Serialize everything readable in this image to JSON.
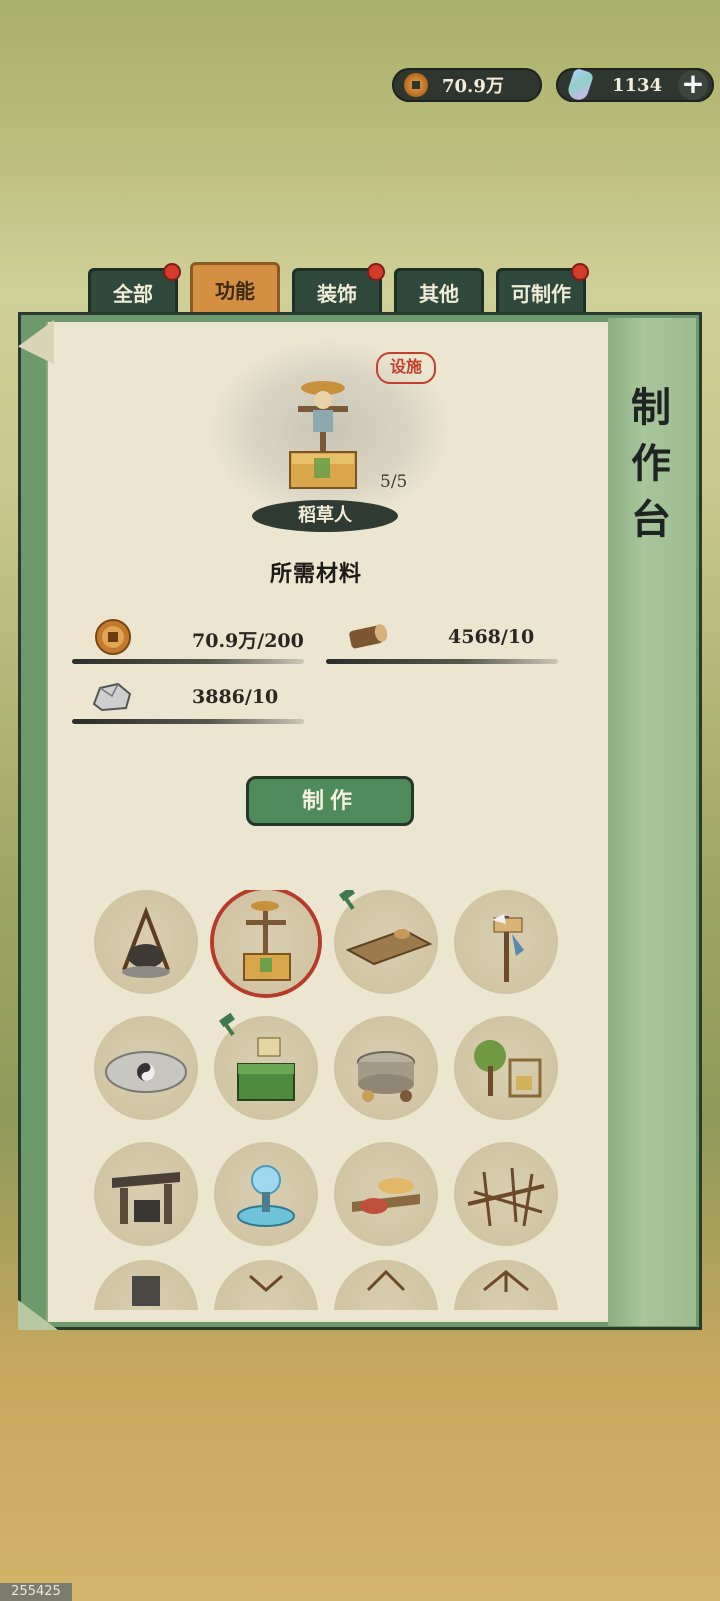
{
  "topbar": {
    "coins": "70.9万",
    "gems": "1134",
    "add_label": "+"
  },
  "tabs": [
    {
      "label": "全部",
      "badge": true,
      "active": false
    },
    {
      "label": "功能",
      "badge": false,
      "active": true
    },
    {
      "label": "装饰",
      "badge": true,
      "active": false
    },
    {
      "label": "其他",
      "badge": false,
      "active": false
    },
    {
      "label": "可制作",
      "badge": true,
      "active": false
    }
  ],
  "panel": {
    "title": "制作台"
  },
  "selected_item": {
    "stamp": "设施",
    "name": "稻草人",
    "count": "5/5",
    "materials_title": "所需材料",
    "materials": [
      {
        "icon": "copper-coin-icon",
        "value": "70.9万/200"
      },
      {
        "icon": "wood-log-icon",
        "value": "4568/10"
      },
      {
        "icon": "stone-icon",
        "value": "3886/10"
      }
    ],
    "craft_label": "制作"
  },
  "items": [
    {
      "name": "cooking-pot-tripod"
    },
    {
      "name": "scarecrow",
      "selected": true
    },
    {
      "name": "wooden-platform",
      "hammer": true
    },
    {
      "name": "bird-perch-signpost"
    },
    {
      "name": "bagua-floor-mat"
    },
    {
      "name": "green-storage-chest",
      "hammer": true
    },
    {
      "name": "stone-millstone"
    },
    {
      "name": "fruit-tree-farm"
    },
    {
      "name": "blacksmith-forge"
    },
    {
      "name": "crystal-orb-fountain"
    },
    {
      "name": "fish-drying-table"
    },
    {
      "name": "weaving-loom"
    },
    {
      "name": "bucket"
    },
    {
      "name": "wooden-frame"
    },
    {
      "name": "tent-frame"
    },
    {
      "name": "rack"
    }
  ],
  "footer_id": "255425",
  "colors": {
    "accent_tab": "#d48f43",
    "button": "#4f8a5b",
    "paper": "#ece6d1",
    "badge": "#d23a2a"
  }
}
